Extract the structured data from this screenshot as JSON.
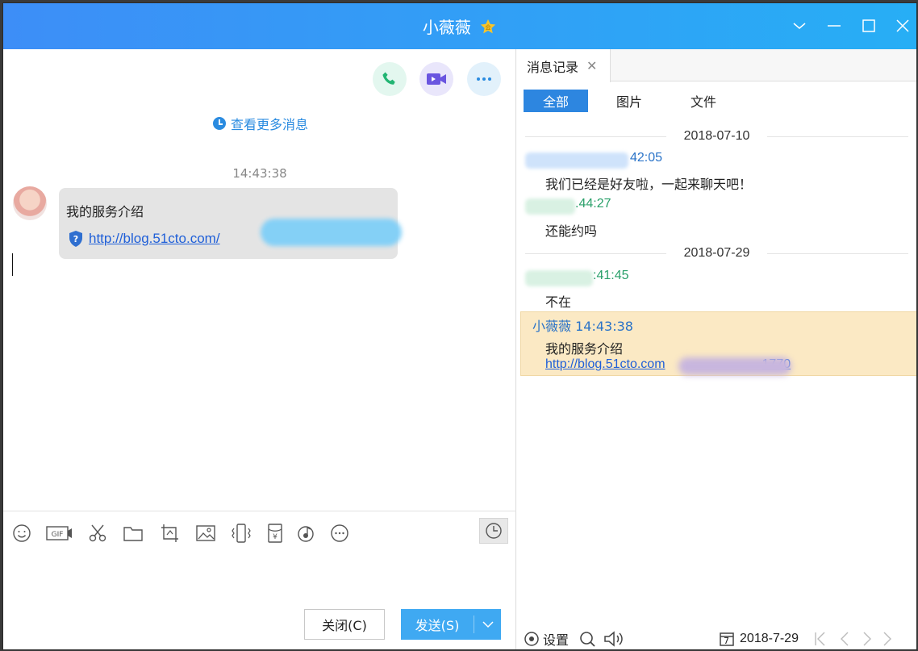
{
  "window": {
    "title": "小薇薇"
  },
  "chat": {
    "more_messages": "查看更多消息",
    "timestamp": "14:43:38",
    "message_text": "我的服务介绍",
    "message_link": "http://blog.51cto.com/",
    "toolbar_icons": [
      "emoji-icon",
      "gif-icon",
      "scissors-icon",
      "folder-icon",
      "screenshot-icon",
      "image-icon",
      "shake-icon",
      "red-packet-icon",
      "music-icon",
      "more-icon"
    ],
    "close_label": "关闭(C)",
    "send_label": "发送(S)"
  },
  "history": {
    "tab_label": "消息记录",
    "filters": [
      "全部",
      "图片",
      "文件"
    ],
    "records": [
      {
        "date": "2018-07-10"
      },
      {
        "time": "42:05",
        "text": "我们已经是好友啦，一起来聊天吧！"
      },
      {
        "time": ".44:27",
        "text": "还能约吗"
      },
      {
        "date": "2018-07-29"
      },
      {
        "time": ":41:45",
        "text": "不在"
      }
    ],
    "highlight": {
      "sender_time": "小薇薇 14:43:38",
      "text": "我的服务介绍",
      "link_start": "http://blog.51cto.com",
      "link_end": "1770"
    },
    "footer": {
      "settings_label": "设置",
      "date_picker_day": "7",
      "date_value": "2018-7-29"
    }
  },
  "colors": {
    "title_bar": "#3d8ef7",
    "accent": "#2d86e0",
    "highlight_row": "#fbe9c4"
  }
}
